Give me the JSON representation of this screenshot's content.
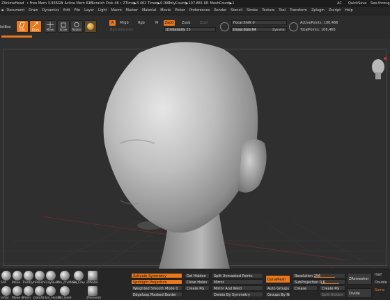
{
  "titlebar": {
    "doc": "ZAnimeHead",
    "stats": [
      "• Free Mem 3.936GB",
      "• Active Mem 628",
      "• Scratch Disk 46",
      "• ZTime▶3.462 Timer▶0.001",
      "• PolyCount▶107.881 KP",
      "• MeshCount▶1"
    ],
    "ac": "AC",
    "quicksave": "QuickSave",
    "seethrough": "See-through"
  },
  "menubar": {
    "items": [
      "Document",
      "Draw",
      "Dynamics",
      "Edit",
      "File",
      "Layer",
      "Light",
      "Macro",
      "Marker",
      "Material",
      "Movie",
      "Picker",
      "Preferences",
      "Render",
      "Stencil",
      "Stroke",
      "Texture",
      "Tool",
      "Transform",
      "Zplugin",
      "Zscript",
      "Help"
    ]
  },
  "toolbar": {
    "left_label": "lotBox",
    "edit": "Edit",
    "draw": "Draw",
    "move": "Move",
    "scale": "Scale",
    "rotate": "Rotate",
    "a_label": "A",
    "mrgb": "Mrgb",
    "rgb": "Rgb",
    "m": "M",
    "zadd": "Zadd",
    "zsub": "Zsub",
    "zcut": "Zcut",
    "rgb_intensity": "Rgb Intensity",
    "z_intensity": "Z Intensity 25",
    "focal_shift": "Focal Shift 0",
    "draw_size": "Draw Size 64",
    "dynamic": "Dynamic",
    "active_points": "ActivePoints: 106,466",
    "total_points": "TotalPoints: 106,466"
  },
  "bottom": {
    "brushes": [
      "Std",
      "Move",
      "TrimDy",
      "hPolish",
      "ClayBuild",
      "Fm_crvMove",
      "Sti_Clay",
      "ZModel",
      "Inflat",
      "Move S",
      "Pnch",
      "DamSt",
      "Sm_HoldR",
      "Sti_Gold",
      "ZRemesh"
    ],
    "activate_symmetry": "Activate Symmetry",
    "spotlight_projection": "Spotlight Projection",
    "weighted_smooth": "Weighted Smooth Mode 0",
    "edgeloop_masked_border": "Edgeloop Masked Border",
    "del_hidden": "Del Hidden",
    "close_holes": "Close Holes",
    "create_pg": "Create PG",
    "split_unmasked_points": "Split Unmasked Points",
    "mirror": "Mirror",
    "mirror_and_weld": "Mirror And Weld",
    "delete_by_symmetry": "Delete By Symmetry",
    "dynamesh": "DynaMesh",
    "auto_groups": "Auto Groups",
    "groups_by_normals": "Groups By Normals",
    "resolution": "Resolution 256",
    "subprojection": "SubProjection 0.6",
    "crease": "Crease",
    "create_pg2": "Create PG",
    "split_hidden": "Split Hidden",
    "zremesher": "ZRemesher",
    "divide": "Divide",
    "half": "Half",
    "double": "Double",
    "same": "Same"
  },
  "colors": {
    "accent": "#e8781e",
    "background": "#2f2f2f"
  }
}
